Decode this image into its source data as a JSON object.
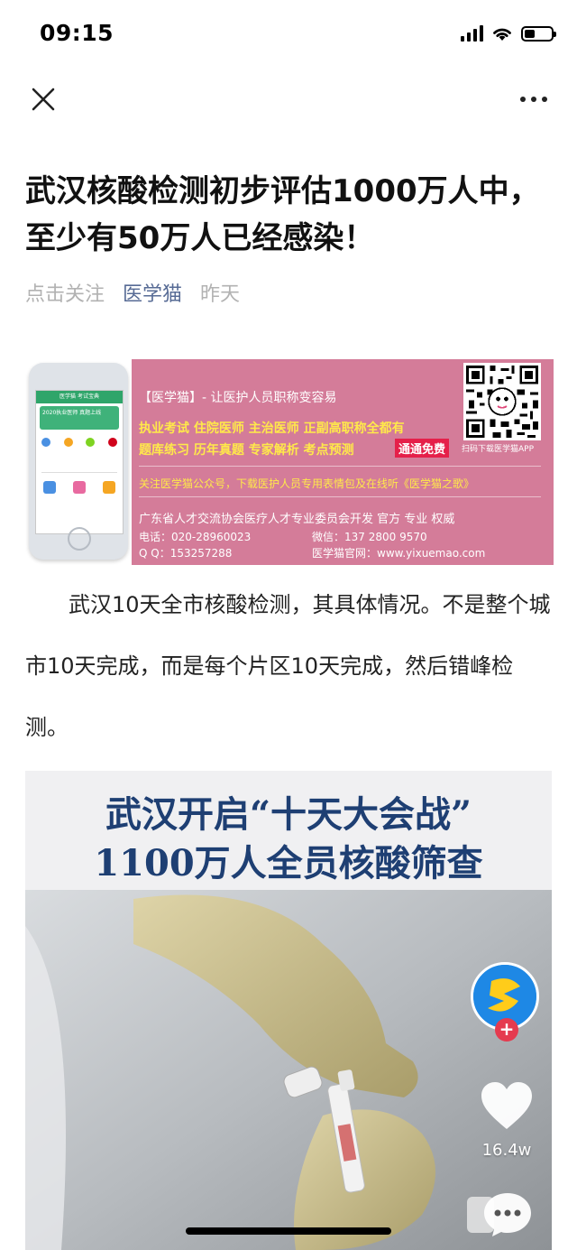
{
  "status_bar": {
    "time": "09:15",
    "battery_level": 0.35
  },
  "nav": {
    "close_icon": "close-icon",
    "more_icon": "more-dots-icon"
  },
  "article": {
    "title": "武汉核酸检测初步评估1000万人中，至少有50万人已经感染！",
    "follow_label": "点击关注",
    "author": "医学猫",
    "date": "昨天",
    "paragraph": "武汉10天全市核酸检测，其具体情况。不是整个城市10天完成，而是每个片区10天完成，然后错峰检测。"
  },
  "banner": {
    "tagline": "【医学猫】- 让医护人员职称变容易",
    "line1": "执业考试 住院医师 主治医师 正副高职称全都有",
    "line2": "题库练习 历年真题 专家解析 考点预测",
    "free_badge": "通通免费",
    "qr_caption": "扫码下载医学猫APP",
    "follow_line": "关注医学猫公众号，下载医护人员专用表情包及在线听《医学猫之歌》",
    "developer_line": "广东省人才交流协会医疗人才专业委员会开发  官方 专业 权威",
    "phone_line": "电话：020-28960023",
    "wechat_line": "微信：137 2800 9570",
    "qq_line": "Q Q：153257288",
    "website_line": "医学猫官网：www.yixuemao.com",
    "phone_mock_title": "医学猫 考试宝典",
    "phone_mock_promo": "2020执业医师 真题上线"
  },
  "video": {
    "headline1": "武汉开启“十天大会战”",
    "headline2": "1100万人全员核酸筛查",
    "like_count": "16.4w",
    "colors": {
      "headline": "#1e3f73",
      "glove": "#cfc496",
      "follow_plus": "#e53b4f"
    }
  }
}
